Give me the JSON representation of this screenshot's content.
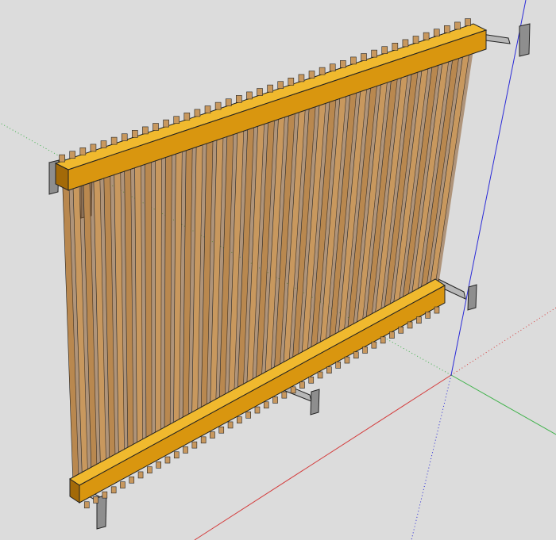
{
  "viewport": {
    "background": "#dcdcdc"
  },
  "axes": {
    "red": "#d43c3c",
    "green": "#3fb24a",
    "blue": "#2a2ad8"
  },
  "model": {
    "slat_light": "#c8985e",
    "slat_dark": "#8a5a2a",
    "rail_face": "#d9960f",
    "rail_top": "#f0b92e",
    "bracket": "#9a9a9a",
    "edge": "#222222"
  }
}
